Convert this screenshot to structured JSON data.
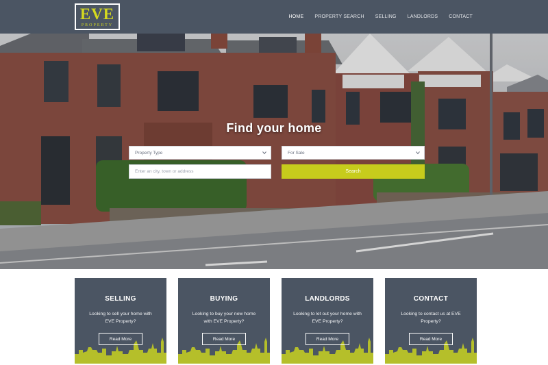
{
  "logo": {
    "main": "EVE",
    "sub": "PROPERTY"
  },
  "nav": {
    "items": [
      {
        "label": "HOME"
      },
      {
        "label": "PROPERTY SEARCH"
      },
      {
        "label": "SELLING"
      },
      {
        "label": "LANDLORDS"
      },
      {
        "label": "CONTACT"
      }
    ]
  },
  "hero": {
    "title": "Find your home",
    "property_type": "Property Type",
    "sale_type": "For Sale",
    "location_placeholder": "Enter an city, town or address",
    "search_label": "Search"
  },
  "cards": [
    {
      "title": "SELLING",
      "desc": "Looking to sell your home with EVE Property?",
      "button": "Read More"
    },
    {
      "title": "BUYING",
      "desc": "Looking to buy your new home with EVE Property?",
      "button": "Read More"
    },
    {
      "title": "LANDLORDS",
      "desc": "Looking to let out your home with EVE Property?",
      "button": "Read More"
    },
    {
      "title": "CONTACT",
      "desc": "Looking to contact us at EVE Property?",
      "button": "Read More"
    }
  ],
  "colors": {
    "header": "#4b5563",
    "accent": "#c7cc1c",
    "logo": "#d4d91f",
    "card": "#4b5563"
  }
}
